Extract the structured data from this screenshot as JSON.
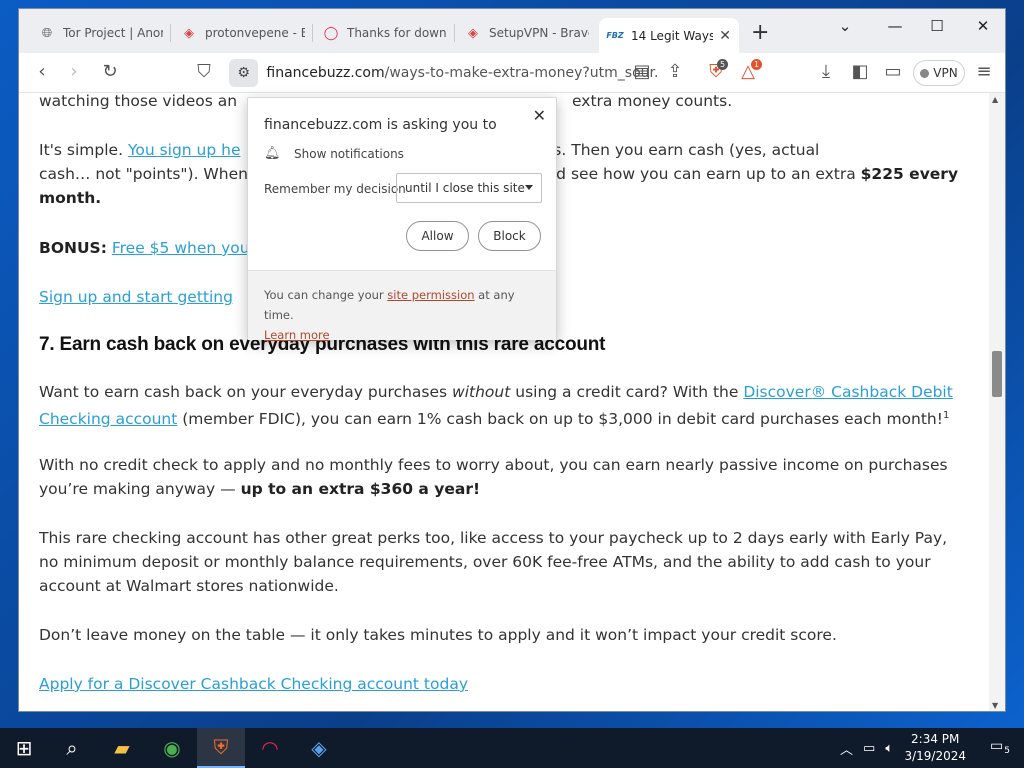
{
  "browser": {
    "tabs": [
      {
        "label": "Tor Project | Anon",
        "icon": "globe-icon"
      },
      {
        "label": "protonvepene - Br",
        "icon": "brave-search-icon"
      },
      {
        "label": "Thanks for downlo",
        "icon": "opera-icon"
      },
      {
        "label": "SetupVPN - Brave",
        "icon": "brave-search-icon"
      },
      {
        "label": "14 Legit Ways",
        "icon": "financebuzz-icon",
        "favicon_text": "FBZ",
        "active": true
      }
    ],
    "url_host": "financebuzz.com",
    "url_path": "/ways-to-make-extra-money?utm_sour...",
    "brave_shield_count": "5",
    "rewards_count": "1",
    "vpn_label": "VPN"
  },
  "popup": {
    "title": "financebuzz.com is asking you to",
    "permission": "Show notifications",
    "remember_label": "Remember my decision",
    "remember_value": "until I close this site",
    "allow_label": "Allow",
    "block_label": "Block",
    "footer_prefix": "You can change your ",
    "footer_link": "site permission",
    "footer_suffix": " at any time.",
    "learn_more": "Learn more"
  },
  "article": {
    "p1_tail": "watching those videos an",
    "p1_tail2": "extra money counts.",
    "p2_a": "It's simple. ",
    "p2_link": "You sign up he",
    "p2_b": "n videos and take surveys. Then you earn cash (yes, actual",
    "p2_c": "cash… not \"points\"). When",
    "p2_d": " and see how you can earn up to an extra ",
    "p2_bold": "$225 every month.",
    "bonus_label": "BONUS:",
    "bonus_link": "Free $5 when you",
    "signup_link": "Sign up and start getting",
    "heading": "7. Earn cash back on everyday purchases with this rare account",
    "p3_a": "Want to earn cash back on your everyday purchases ",
    "p3_em": "without",
    "p3_b": " using a credit card? With the ",
    "p3_link": "Discover® Cashback Debit Checking account",
    "p3_c": " (member FDIC), you can earn 1% cash back on up to $3,000 in debit card purchases each month!",
    "p3_sup": "1",
    "p4_a": "With no credit check to apply and no monthly fees to worry about, you can earn nearly passive income on purchases you’re making anyway — ",
    "p4_bold": "up to an extra $360 a year!",
    "p5": "This rare checking account has other great perks too, like access to your paycheck up to 2 days early with Early Pay, no minimum deposit or monthly balance requirements, over 60K fee-free ATMs, and the ability to add cash to your account at Walmart stores nationwide.",
    "p6": "Don’t leave money on the table — it only takes minutes to apply and it won’t impact your credit score.",
    "apply_link": "Apply for a Discover Cashback Checking account today"
  },
  "taskbar": {
    "time": "2:34 PM",
    "date": "3/19/2024",
    "notification_count": "5"
  }
}
